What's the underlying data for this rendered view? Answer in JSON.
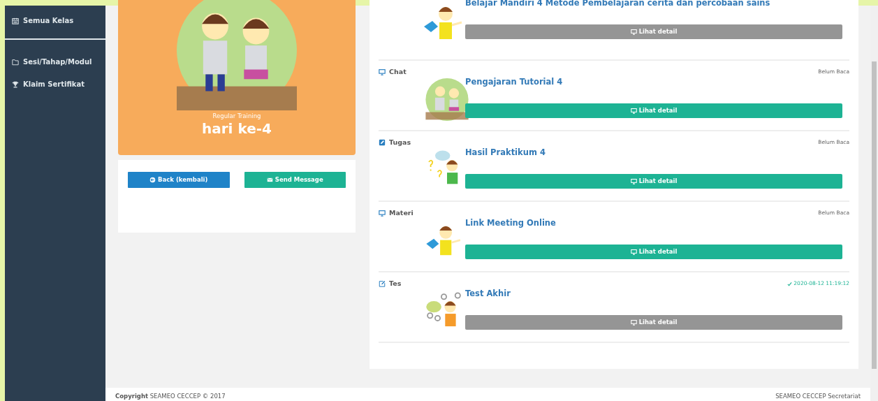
{
  "sidebar": {
    "items": [
      {
        "label": "Semua Kelas"
      },
      {
        "label": "Sesi/Tahap/Modul"
      },
      {
        "label": "Klaim Sertifikat"
      }
    ]
  },
  "session_card": {
    "subtitle": "Regular Training",
    "title": "hari ke-4"
  },
  "actions": [
    {
      "label": "Back (kembali)",
      "kind": "back"
    },
    {
      "label": "Send Message",
      "kind": "message"
    }
  ],
  "activities": [
    {
      "kind": "reading",
      "title": "Belajar Mandiri 4 Metode Pembelajaran cerita dan percobaan sains",
      "button": {
        "label": "Lihat detail",
        "disabled": true
      }
    },
    {
      "kind": "chat",
      "category": "Chat",
      "status": {
        "kind": "unread",
        "text": "Belum Baca"
      },
      "title": "Pengajaran Tutorial 4",
      "button": {
        "label": "Lihat detail",
        "disabled": false
      }
    },
    {
      "kind": "task",
      "category": "Tugas",
      "status": {
        "kind": "unread",
        "text": "Belum Baca"
      },
      "title": "Hasil Praktikum 4",
      "button": {
        "label": "Lihat detail",
        "disabled": false
      }
    },
    {
      "kind": "material",
      "category": "Materi",
      "status": {
        "kind": "unread",
        "text": "Belum Baca"
      },
      "title": "Link Meeting Online",
      "button": {
        "label": "Lihat detail",
        "disabled": false
      }
    },
    {
      "kind": "test",
      "category": "Tes",
      "status": {
        "kind": "done",
        "text": "2020-08-12 11:19:12"
      },
      "title": "Test Akhir",
      "button": {
        "label": "Lihat detail",
        "disabled": true
      }
    }
  ],
  "footer": {
    "left_bold": "Copyright",
    "left": "SEAMEO CECCEP © 2017",
    "right": "SEAMEO CECCEP Secretariat"
  }
}
